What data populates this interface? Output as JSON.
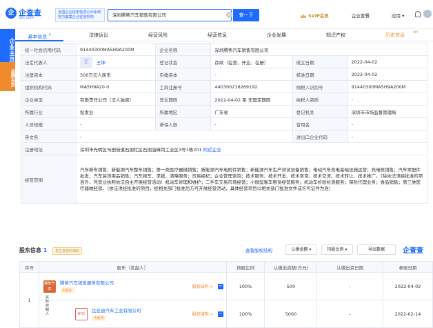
{
  "header": {
    "logo_text": "企查查",
    "logo_mark": "企",
    "logo_domain": "Qcc.com",
    "cert_line1": "全国企业信用信息公示系统",
    "cert_line2": "官方备案企业征信机构",
    "search_value": "深圳腾势汽车销售有限公司",
    "search_button": "查一下",
    "nav_svip": "SVIP会员",
    "nav_kit": "企业套餐",
    "nav_app": "应用 ▾"
  },
  "side": {
    "tab1": "企业主页",
    "tab2": "品牌主页"
  },
  "tabs": [
    {
      "label": "基本信息",
      "count": "9"
    },
    {
      "label": "法律诉讼",
      "count": ""
    },
    {
      "label": "经营风险",
      "count": ""
    },
    {
      "label": "经营信息",
      "count": ""
    },
    {
      "label": "企业发展",
      "count": ""
    },
    {
      "label": "知识产权",
      "count": ""
    },
    {
      "label": "历史信息",
      "count": ""
    }
  ],
  "vip_badge": "VIP",
  "info": {
    "uscc_k": "统一社会信用代码",
    "uscc_v": "91440300MA5H9A200M",
    "name_k": "企业名称",
    "name_v": "深圳腾势汽车销售有限公司",
    "rep_k": "法定代表人",
    "rep_avatar": "王",
    "rep_v": "王坤",
    "status_k": "登记状态",
    "status_v": "存续（在营、开业、在册）",
    "found_k": "成立日期",
    "found_v": "2022-04-02",
    "cap_k": "注册资本",
    "cap_v": "500万元人民币",
    "paid_k": "实缴资本",
    "paid_v": "-",
    "approve_k": "核准日期",
    "approve_v": "2022-04-02",
    "org_k": "组织机构代码",
    "org_v": "MA5H9A20-0",
    "regno_k": "工商注册号",
    "regno_v": "440300216269192",
    "tax_k": "纳税人识别号",
    "tax_v": "91440300MA5H9A200M",
    "type_k": "企业类型",
    "type_v": "有限责任公司（法人独资）",
    "term_k": "营业期限",
    "term_v": "2022-04-02 至 无固定期限",
    "taxq_k": "纳税人资质",
    "taxq_v": "-",
    "ind_k": "所属行业",
    "ind_v": "批发业",
    "area_k": "所属地区",
    "area_v": "广东省",
    "auth_k": "登记机关",
    "auth_v": "深圳市市场监督管理局",
    "staff_k": "人员规模",
    "staff_v": "-",
    "ins_k": "参保人数",
    "ins_v": "-",
    "used_k": "曾用名",
    "used_v": "-",
    "en_k": "英文名",
    "en_v": "-",
    "imp_k": "进出口企业代码",
    "imp_v": "-",
    "addr_k": "注册地址",
    "addr_v": "深圳市光明区马田街道石围社区石围油麻岗工业区3号1栋201",
    "addr_link": "附近企业",
    "scope_k": "经营范围",
    "scope_v": "汽车新车销售；新能源汽车整车销售；第一类医疗器械销售；新能源汽车电附件销售；新能源汽车生产测试设备销售；电动汽车充电基础设施运营；充电桩销售；汽车零配件批发；汽车装饰用品销售；汽车拖车、求援、清障服务；贸易经纪；企业管理咨询；技术服务、技术开发、技术咨询、技术交流、技术转让、技术推广。（除依法须经批准的项目外，凭营业执照依法自主开展经营活动）机动车修理和维护；二手车交易市场经营；小微型客车租赁经营服务；机动车检验检测服务；保险代理业务；食品销售；第三类医疗器械经营。（依法须经批准的项目，经相关部门批准后方可开展经营活动，具体经营项目以相关部门批准文件或许可证件为准）"
  },
  "shareholders": {
    "title": "股东信息",
    "count": "1",
    "notice": "发生变更时通知",
    "view_link": "查看股权结构",
    "btn_paid": "认缴金额 ▾",
    "btn_ratio": "持股比例 ▾",
    "btn_export": "导出数据",
    "logo": "企查查",
    "headers": [
      "序号",
      "股东（发起人）",
      "持股比例",
      "认缴出资额(万元)",
      "认缴出资日期",
      "参股日期"
    ],
    "rows": [
      {
        "no": "1",
        "logo": "腾势汽车",
        "name": "腾势汽车销售服务有限公司",
        "tag": "大股东",
        "eq": "股权结构 >",
        "ratio": "100%",
        "amount": "500",
        "date": "-",
        "join": "2022-04-02"
      },
      {
        "no": "",
        "logo": "BYD",
        "name": "比亚迪汽车工业有限公司",
        "tag": "大股东",
        "eq": "股权结构 >",
        "ratio": "100%",
        "amount": "5000",
        "date": "-",
        "join": "2022-02-14"
      }
    ],
    "branch_label": "实际控制人"
  },
  "colors": {
    "brand": "#1e6bff",
    "accent": "#f08a2c",
    "gold": "#c8902e"
  }
}
